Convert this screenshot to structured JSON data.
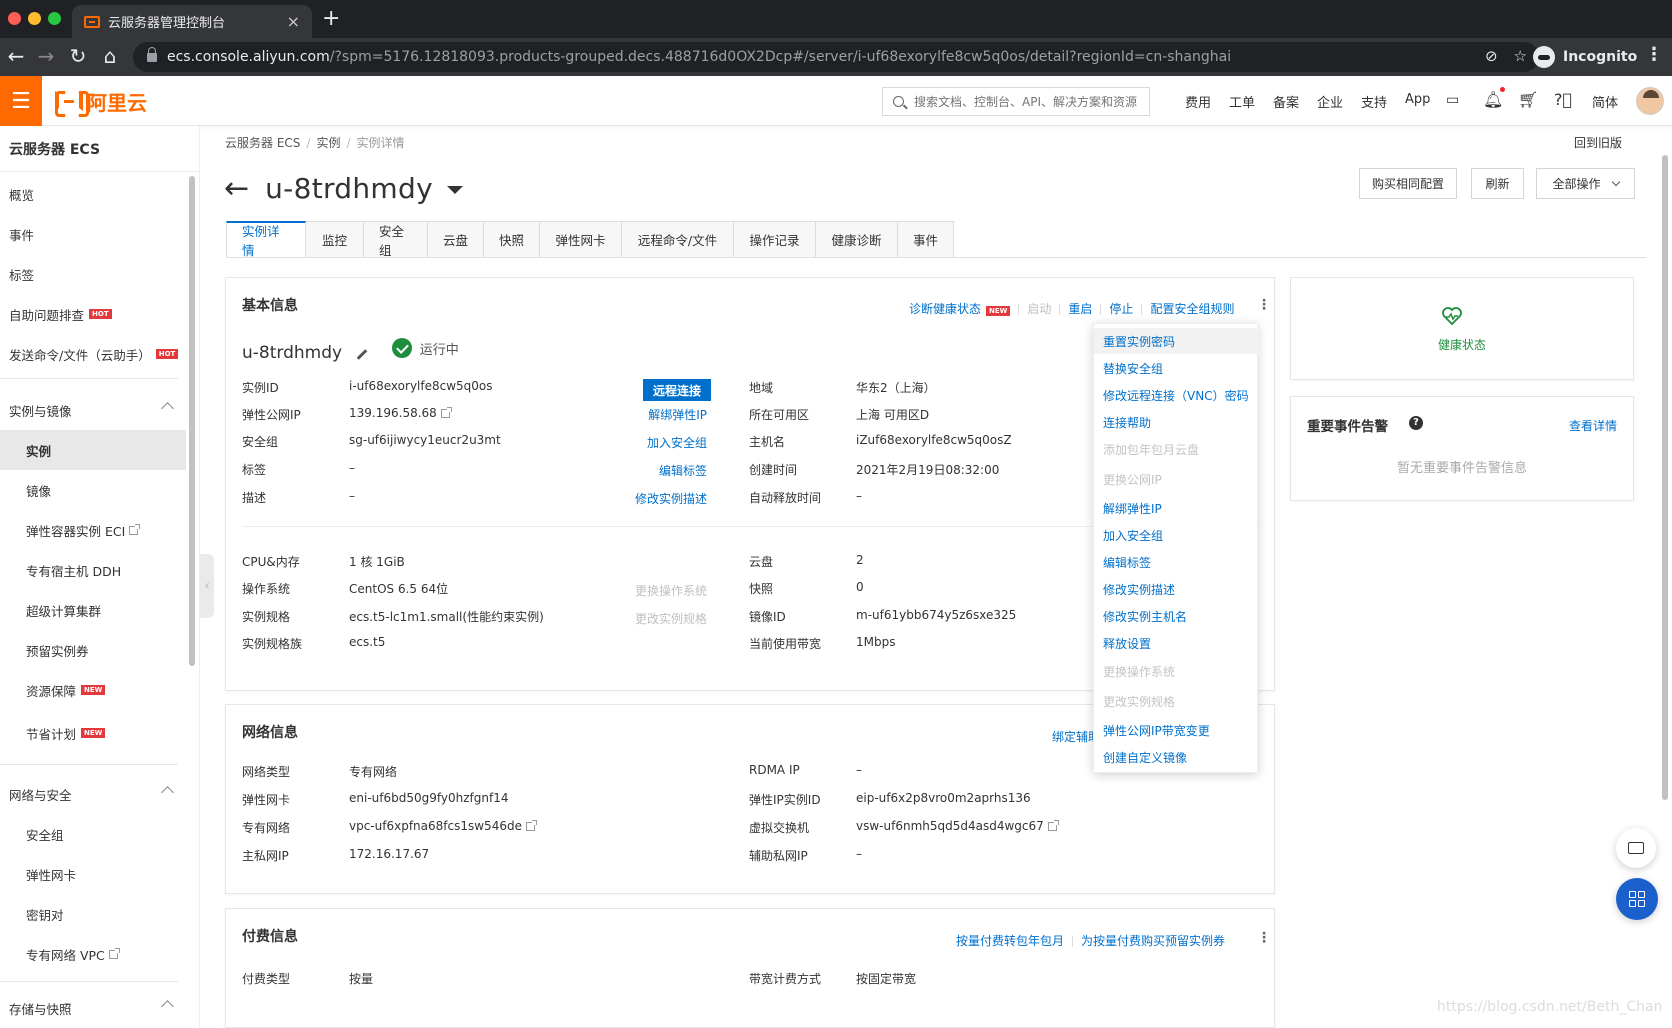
{
  "browser": {
    "tab_title": "云服务器管理控制台",
    "tab_close": "×",
    "new_tab": "+",
    "url_host": "ecs.console.aliyun.com",
    "url_path": "/?spm=5176.12818093.products-grouped.decs.488716d0OX2Dcp#/server/i-uf68exorylfe8cw5q0os/detail?regionId=cn-shanghai",
    "profile": "Incognito"
  },
  "header": {
    "brand": "阿里云",
    "search_placeholder": "搜索文档、控制台、API、解决方案和资源",
    "nav": [
      "费用",
      "工单",
      "备案",
      "企业",
      "支持",
      "App"
    ],
    "lang": "简体"
  },
  "sidebar": {
    "title": "云服务器 ECS",
    "top_items": [
      {
        "label": "概览"
      },
      {
        "label": "事件"
      },
      {
        "label": "标签"
      },
      {
        "label": "自助问题排查",
        "badge": "HOT"
      },
      {
        "label": "发送命令/文件（云助手）",
        "badge": "HOT"
      }
    ],
    "group1": "实例与镜像",
    "group1_items": [
      {
        "label": "实例"
      },
      {
        "label": "镜像"
      },
      {
        "label": "弹性容器实例 ECI"
      },
      {
        "label": "专有宿主机 DDH"
      },
      {
        "label": "超级计算集群"
      },
      {
        "label": "预留实例券"
      },
      {
        "label": "资源保障",
        "badge": "NEW"
      },
      {
        "label": "节省计划",
        "badge": "NEW"
      }
    ],
    "group2": "网络与安全",
    "group2_items": [
      {
        "label": "安全组"
      },
      {
        "label": "弹性网卡"
      },
      {
        "label": "密钥对"
      },
      {
        "label": "专有网络 VPC"
      }
    ],
    "group3": "存储与快照"
  },
  "breadcrumb": [
    "云服务器 ECS",
    "实例",
    "实例详情"
  ],
  "old_version": "回到旧版",
  "instance_title": "u-8trdhmdy",
  "top_buttons": {
    "buy_same": "购买相同配置",
    "refresh": "刷新",
    "all_ops": "全部操作"
  },
  "tabs": [
    "实例详情",
    "监控",
    "安全组",
    "云盘",
    "快照",
    "弹性网卡",
    "远程命令/文件",
    "操作记录",
    "健康诊断",
    "事件"
  ],
  "basic": {
    "title": "基本信息",
    "actions": {
      "diagnose": "诊断健康状态",
      "diagnose_badge": "NEW",
      "start": "启动",
      "restart": "重启",
      "stop": "停止",
      "config_sg": "配置安全组规则"
    },
    "name": "u-8trdhmdy",
    "status": "运行中",
    "left_rows": [
      {
        "label": "实例ID",
        "value": "i-uf68exorylfe8cw5q0os"
      },
      {
        "label": "弹性公网IP",
        "value": "139.196.58.68"
      },
      {
        "label": "安全组",
        "value": "sg-uf6ijiwycy1eucr2u3mt"
      },
      {
        "label": "标签",
        "value": "–"
      },
      {
        "label": "描述",
        "value": "–"
      }
    ],
    "left_actions": {
      "remote": "远程连接",
      "unbind_eip": "解绑弹性IP",
      "join_sg": "加入安全组",
      "edit_tag": "编辑标签",
      "edit_desc": "修改实例描述"
    },
    "right_rows": [
      {
        "label": "地域",
        "value": "华东2（上海）"
      },
      {
        "label": "所在可用区",
        "value": "上海 可用区D"
      },
      {
        "label": "主机名",
        "value": "iZuf68exorylfe8cw5q0osZ"
      },
      {
        "label": "创建时间",
        "value": "2021年2月19日08:32:00"
      },
      {
        "label": "自动释放时间",
        "value": "–"
      }
    ],
    "spec_left": [
      {
        "label": "CPU&内存",
        "value": "1 核 1GiB"
      },
      {
        "label": "操作系统",
        "value": "CentOS 6.5 64位"
      },
      {
        "label": "实例规格",
        "value": "ecs.t5-lc1m1.small(性能约束实例)"
      },
      {
        "label": "实例规格族",
        "value": "ecs.t5"
      }
    ],
    "spec_actions": {
      "change_os": "更换操作系统",
      "change_spec": "更改实例规格"
    },
    "spec_right": [
      {
        "label": "云盘",
        "value": "2"
      },
      {
        "label": "快照",
        "value": "0"
      },
      {
        "label": "镜像ID",
        "value": "m-uf61ybb674y5z6sxe325"
      },
      {
        "label": "当前使用带宽",
        "value": "1Mbps"
      }
    ]
  },
  "dropdown": [
    {
      "label": "重置实例密码",
      "state": "hover"
    },
    {
      "label": "替换安全组",
      "state": "normal"
    },
    {
      "label": "修改远程连接（VNC）密码",
      "state": "normal"
    },
    {
      "label": "连接帮助",
      "state": "normal"
    },
    {
      "label": "添加包年包月云盘",
      "state": "disabled"
    },
    {
      "label": "更换公网IP",
      "state": "disabled"
    },
    {
      "label": "解绑弹性IP",
      "state": "normal"
    },
    {
      "label": "加入安全组",
      "state": "normal"
    },
    {
      "label": "编辑标签",
      "state": "normal"
    },
    {
      "label": "修改实例描述",
      "state": "normal"
    },
    {
      "label": "修改实例主机名",
      "state": "normal"
    },
    {
      "label": "释放设置",
      "state": "normal"
    },
    {
      "label": "更换操作系统",
      "state": "disabled"
    },
    {
      "label": "更改实例规格",
      "state": "disabled"
    },
    {
      "label": "弹性公网IP带宽变更",
      "state": "normal"
    },
    {
      "label": "创建自定义镜像",
      "state": "normal"
    }
  ],
  "network": {
    "title": "网络信息",
    "action": "绑定辅助",
    "left_rows": [
      {
        "label": "网络类型",
        "value": "专有网络"
      },
      {
        "label": "弹性网卡",
        "value": "eni-uf6bd50g9fy0hzfgnf14"
      },
      {
        "label": "专有网络",
        "value": "vpc-uf6xpfna68fcs1sw546de"
      },
      {
        "label": "主私网IP",
        "value": "172.16.17.67"
      }
    ],
    "right_rows": [
      {
        "label": "RDMA IP",
        "value": "–"
      },
      {
        "label": "弹性IP实例ID",
        "value": "eip-uf6x2p8vro0m2aprhs136"
      },
      {
        "label": "虚拟交换机",
        "value": "vsw-uf6nmh5qd5d4asd4wgc67"
      },
      {
        "label": "辅助私网IP",
        "value": "–"
      }
    ]
  },
  "billing": {
    "title": "付费信息",
    "action1": "按量付费转包年包月",
    "action2": "为按量付费购买预留实例券",
    "left_rows": [
      {
        "label": "付费类型",
        "value": "按量"
      }
    ],
    "right_rows": [
      {
        "label": "带宽计费方式",
        "value": "按固定带宽"
      }
    ]
  },
  "health_panel": {
    "label": "健康状态"
  },
  "events_panel": {
    "title": "重要事件告警",
    "link": "查看详情",
    "empty": "暂无重要事件告警信息"
  },
  "watermark": "https://blog.csdn.net/Beth_Chan",
  "colors": {
    "brand": "#ff6a00",
    "link": "#0070cc",
    "success": "#1e8e3e",
    "badge": "#e4393c"
  }
}
